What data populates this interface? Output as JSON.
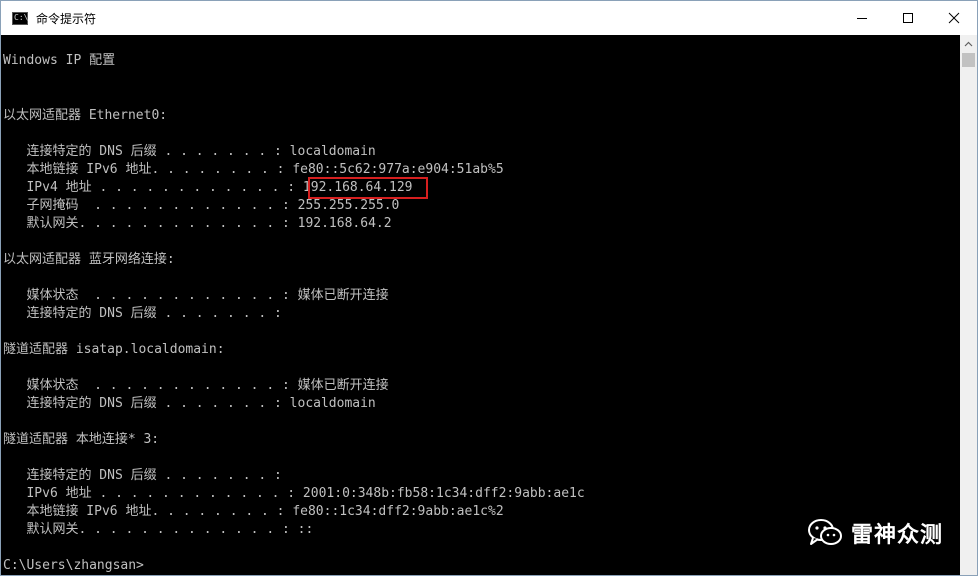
{
  "window": {
    "title": "命令提示符",
    "icon": "console-app-icon",
    "icon_glyph": "C:\\"
  },
  "controls": {
    "minimize_icon": "minimize-icon",
    "maximize_icon": "maximize-icon",
    "close_icon": "close-icon"
  },
  "console": {
    "lines": [
      "Windows IP 配置",
      "",
      "",
      "以太网适配器 Ethernet0:",
      "",
      "   连接特定的 DNS 后缀 . . . . . . . : localdomain",
      "   本地链接 IPv6 地址. . . . . . . . : fe80::5c62:977a:e904:51ab%5",
      "   IPv4 地址 . . . . . . . . . . . . : 192.168.64.129",
      "   子网掩码  . . . . . . . . . . . . : 255.255.255.0",
      "   默认网关. . . . . . . . . . . . . : 192.168.64.2",
      "",
      "以太网适配器 蓝牙网络连接:",
      "",
      "   媒体状态  . . . . . . . . . . . . : 媒体已断开连接",
      "   连接特定的 DNS 后缀 . . . . . . . :",
      "",
      "隧道适配器 isatap.localdomain:",
      "",
      "   媒体状态  . . . . . . . . . . . . : 媒体已断开连接",
      "   连接特定的 DNS 后缀 . . . . . . . : localdomain",
      "",
      "隧道适配器 本地连接* 3:",
      "",
      "   连接特定的 DNS 后缀 . . . . . . . :",
      "   IPv6 地址 . . . . . . . . . . . . : 2001:0:348b:fb58:1c34:dff2:9abb:ae1c",
      "   本地链接 IPv6 地址. . . . . . . . : fe80::1c34:dff2:9abb:ae1c%2",
      "   默认网关. . . . . . . . . . . . . : ::",
      "",
      "C:\\Users\\zhangsan>"
    ],
    "highlighted_value": "192.168.64.129",
    "highlight_color": "#d61f1f",
    "text_color": "#c0c0c0",
    "background_color": "#000000"
  },
  "watermark": {
    "text": "雷神众测",
    "icon": "wechat-icon"
  }
}
